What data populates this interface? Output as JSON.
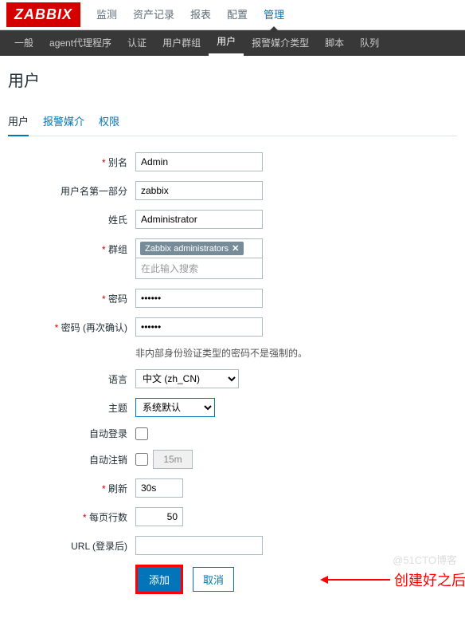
{
  "logo": "ZABBIX",
  "topNav": {
    "items": [
      "监测",
      "资产记录",
      "报表",
      "配置",
      "管理"
    ],
    "activeIndex": 4
  },
  "subNav": {
    "items": [
      "一般",
      "agent代理程序",
      "认证",
      "用户群组",
      "用户",
      "报警媒介类型",
      "脚本",
      "队列"
    ],
    "activeIndex": 4
  },
  "pageTitle": "用户",
  "tabs": {
    "items": [
      "用户",
      "报警媒介",
      "权限"
    ],
    "activeIndex": 0
  },
  "form": {
    "alias": {
      "label": "别名",
      "value": "Admin"
    },
    "firstName": {
      "label": "用户名第一部分",
      "value": "zabbix"
    },
    "lastName": {
      "label": "姓氏",
      "value": "Administrator"
    },
    "group": {
      "label": "群组",
      "tag": "Zabbix administrators",
      "placeholder": "在此输入搜索"
    },
    "password": {
      "label": "密码",
      "value": "••••••"
    },
    "passwordConfirm": {
      "label": "密码 (再次确认)",
      "value": "••••••"
    },
    "passwordHint": "非内部身份验证类型的密码不是强制的。",
    "language": {
      "label": "语言",
      "value": "中文 (zh_CN)"
    },
    "theme": {
      "label": "主题",
      "value": "系统默认"
    },
    "autoLogin": {
      "label": "自动登录"
    },
    "autoLogout": {
      "label": "自动注销",
      "value": "15m"
    },
    "refresh": {
      "label": "刷新",
      "value": "30s"
    },
    "rowsPerPage": {
      "label": "每页行数",
      "value": "50"
    },
    "urlAfterLogin": {
      "label": "URL (登录后)",
      "value": ""
    }
  },
  "buttons": {
    "add": "添加",
    "cancel": "取消"
  },
  "annotation": "创建好之后添加",
  "watermark": "@51CTO博客"
}
